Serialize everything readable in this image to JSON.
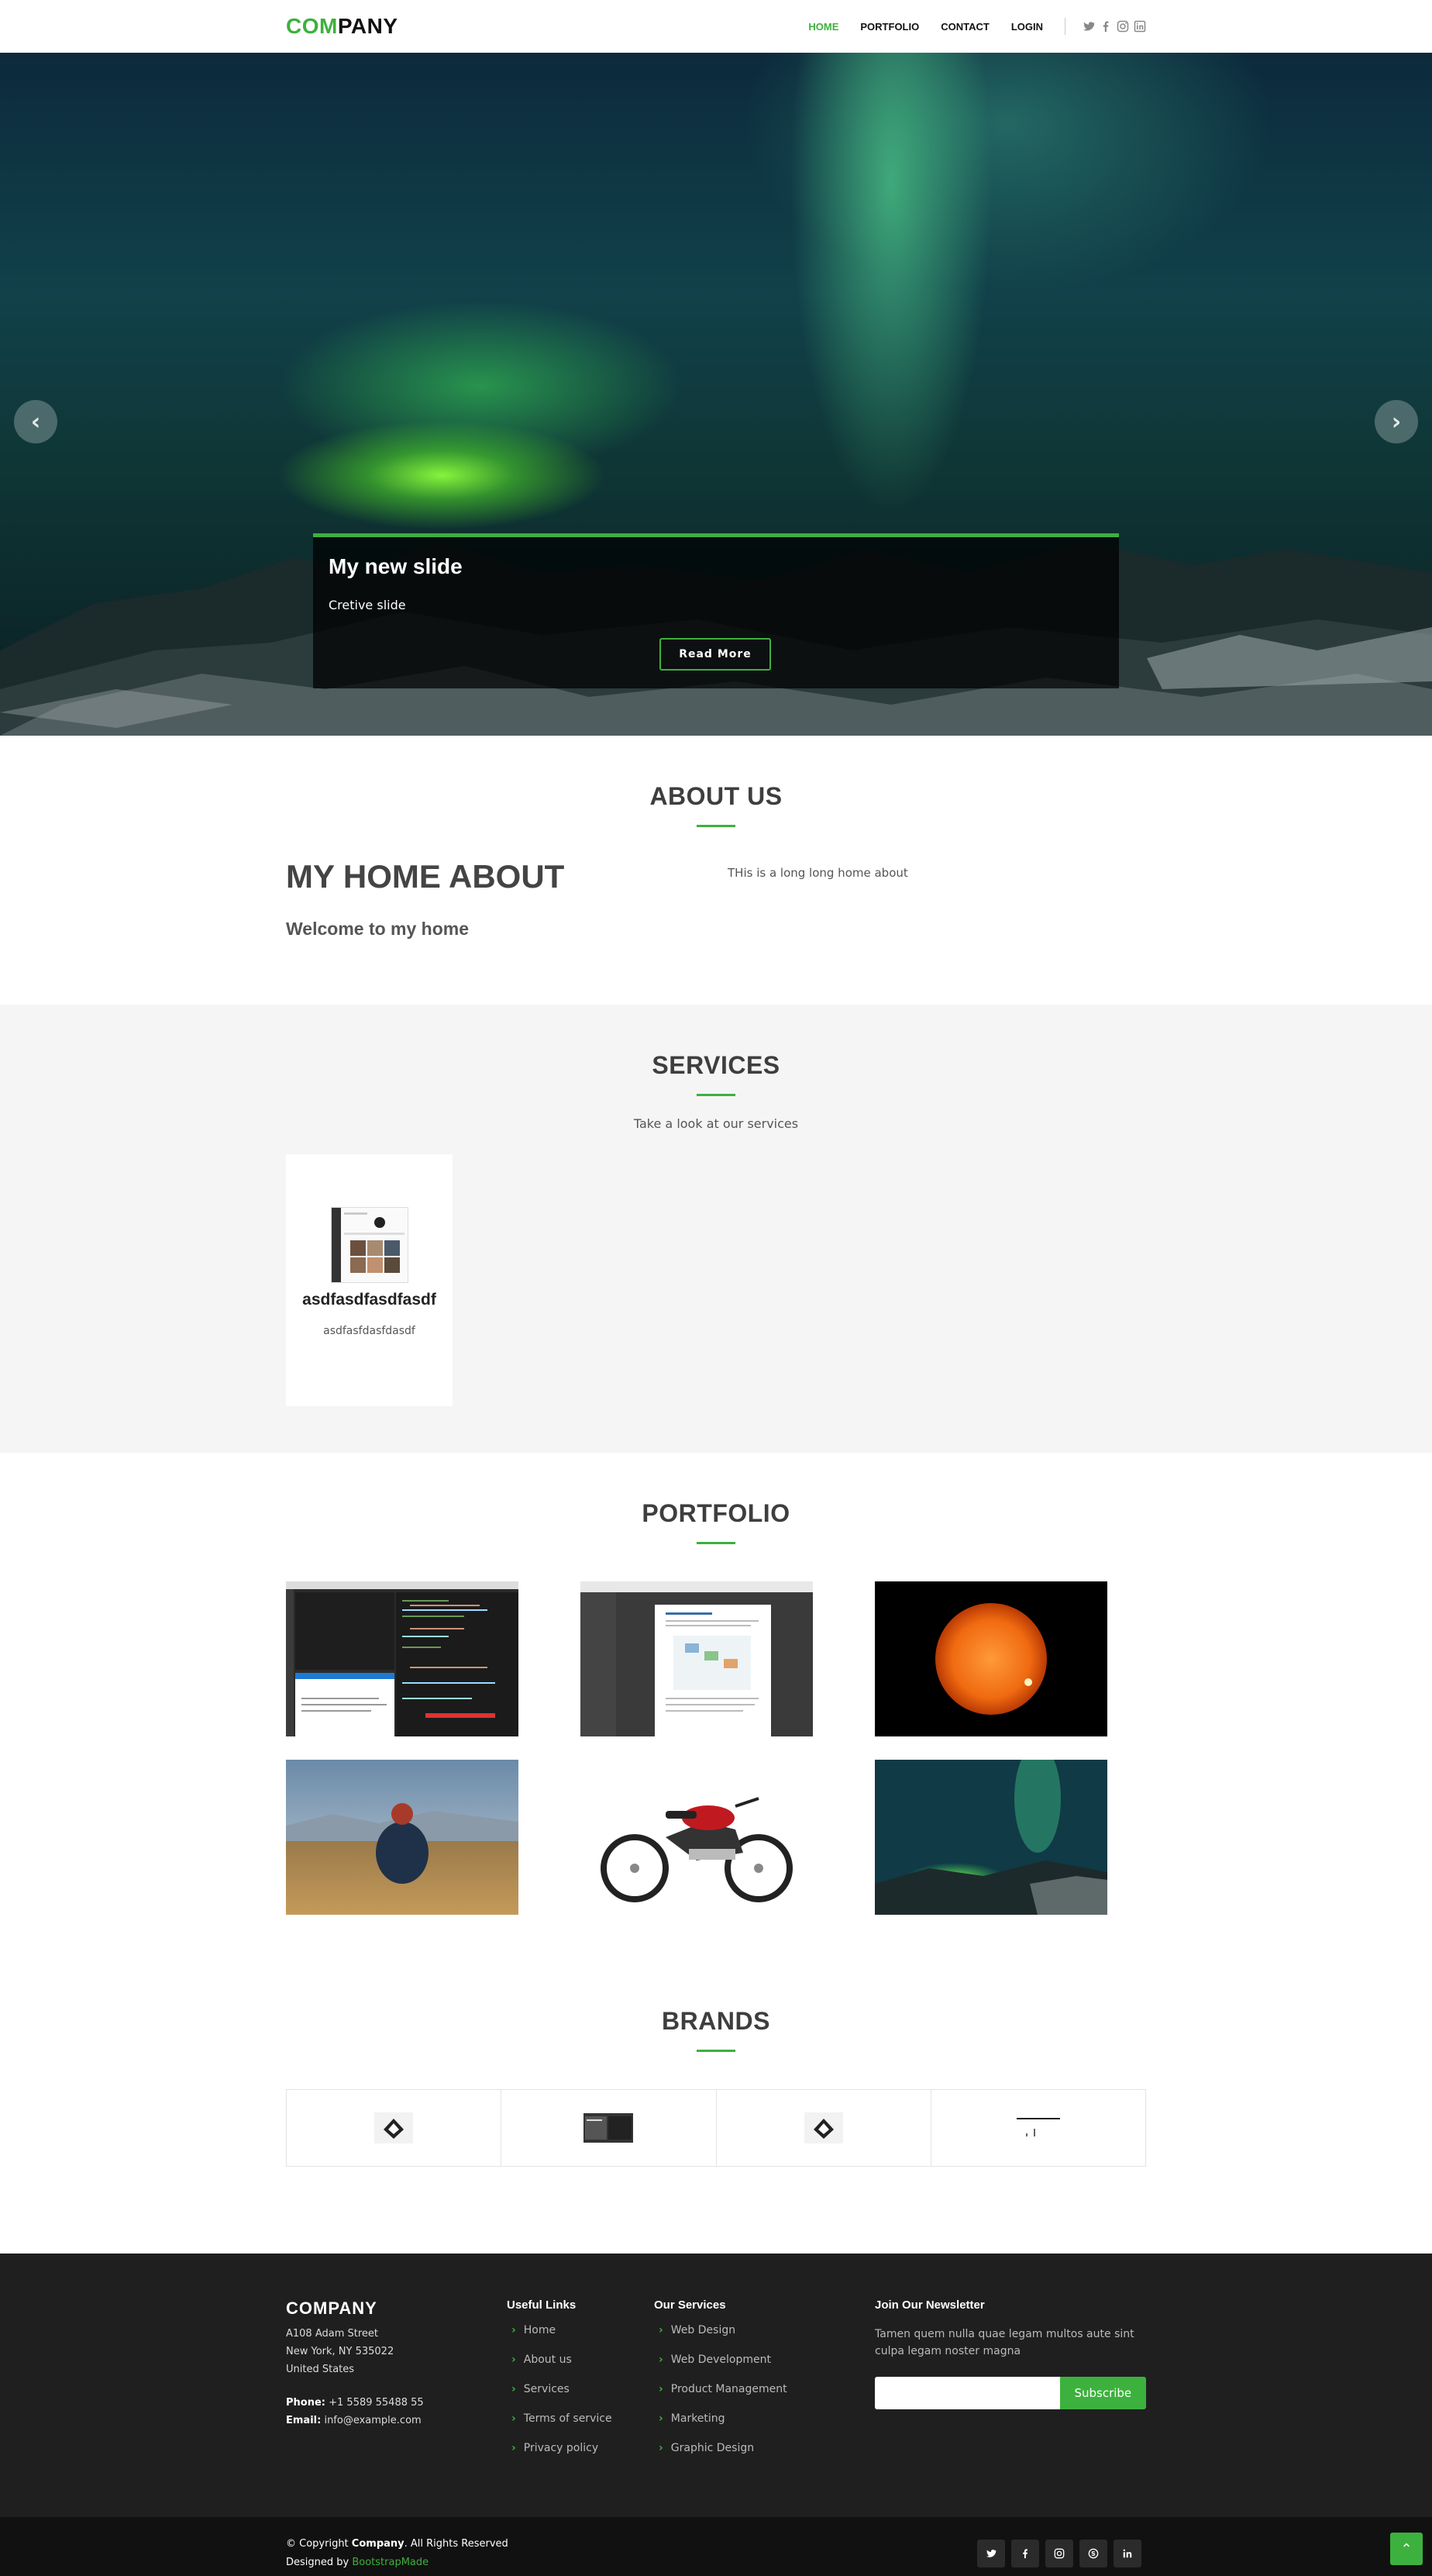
{
  "header": {
    "logo_accent": "COM",
    "logo_rest": "PANY",
    "nav": [
      {
        "label": "HOME",
        "active": true
      },
      {
        "label": "PORTFOLIO",
        "active": false
      },
      {
        "label": "CONTACT",
        "active": false
      },
      {
        "label": "LOGIN",
        "active": false
      }
    ],
    "social_icons": [
      "twitter-icon",
      "facebook-icon",
      "instagram-icon",
      "linkedin-icon"
    ]
  },
  "hero": {
    "slide_title": "My new slide",
    "slide_text": "Cretive slide",
    "button_label": "Read More",
    "slide_count": 3,
    "active_slide": 1
  },
  "about": {
    "title": "ABOUT US",
    "heading": "MY HOME ABOUT",
    "subheading": "Welcome to my home",
    "text": "THis is a long long home about"
  },
  "services": {
    "title": "SERVICES",
    "subtitle": "Take a look at our services",
    "items": [
      {
        "title": "asdfasdfasdfasdf",
        "description": "asdfasfdasfdasdf"
      }
    ]
  },
  "portfolio": {
    "title": "PORTFOLIO",
    "items": [
      "code-editor-screenshot",
      "document-screenshot",
      "sun-photo",
      "person-field-photo",
      "motorcycle-photo",
      "aurora-photo"
    ]
  },
  "brands": {
    "title": "BRANDS",
    "items": [
      "brand-logo-1",
      "brand-logo-2",
      "brand-logo-3",
      "brand-logo-4"
    ]
  },
  "footer": {
    "company": "COMPANY",
    "address_line1": "A108 Adam Street",
    "address_line2": "New York, NY 535022",
    "address_line3": "United States",
    "phone_label": "Phone:",
    "phone": "+1 5589 55488 55",
    "email_label": "Email:",
    "email": "info@example.com",
    "useful_links_title": "Useful Links",
    "useful_links": [
      "Home",
      "About us",
      "Services",
      "Terms of service",
      "Privacy policy"
    ],
    "services_title": "Our Services",
    "services_links": [
      "Web Design",
      "Web Development",
      "Product Management",
      "Marketing",
      "Graphic Design"
    ],
    "newsletter_title": "Join Our Newsletter",
    "newsletter_text": "Tamen quem nulla quae legam multos aute sint culpa legam noster magna",
    "newsletter_button": "Subscribe",
    "copyright_prefix": "© Copyright",
    "copyright_company": "Company",
    "copyright_suffix": ". All Rights Reserved",
    "designed_by_prefix": "Designed by",
    "designed_by": "BootstrapMade",
    "social": [
      "t",
      "f",
      "◎",
      "s",
      "in"
    ]
  },
  "colors": {
    "accent": "#3db13d",
    "footer_bg": "#1f1f1f",
    "footer_bottom_bg": "#111111"
  }
}
